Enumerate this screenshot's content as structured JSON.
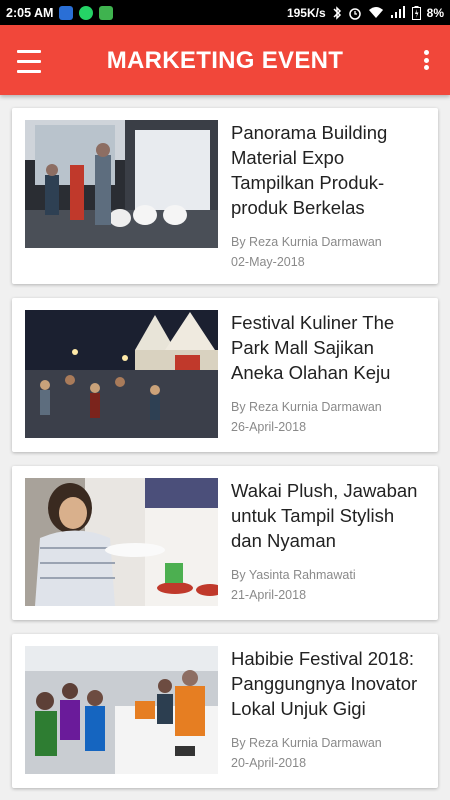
{
  "status_bar": {
    "time": "2:05 AM",
    "net_speed": "195K/s",
    "battery": "8%"
  },
  "app_bar": {
    "title": "MARKETING EVENT"
  },
  "articles": [
    {
      "title": "Panorama Building Material Expo Tampilkan Produk-produk Berkelas",
      "author": "By Reza Kurnia Darmawan",
      "date": "02-May-2018"
    },
    {
      "title": "Festival Kuliner The Park Mall Sajikan Aneka Olahan Keju",
      "author": "By Reza Kurnia Darmawan",
      "date": "26-April-2018"
    },
    {
      "title": "Wakai Plush, Jawaban untuk Tampil Stylish dan Nyaman",
      "author": "By Yasinta Rahmawati",
      "date": "21-April-2018"
    },
    {
      "title": "Habibie Festival 2018: Panggungnya Inovator Lokal Unjuk Gigi",
      "author": "By Reza Kurnia Darmawan",
      "date": "20-April-2018"
    }
  ],
  "colors": {
    "primary": "#f1473a",
    "background": "#f0f0f0",
    "card": "#ffffff",
    "title_text": "#222222",
    "meta_text": "#8a8a8a"
  }
}
